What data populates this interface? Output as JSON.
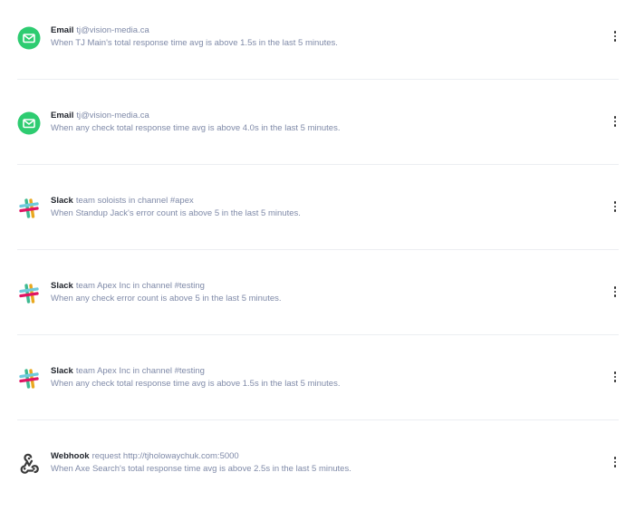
{
  "colors": {
    "email_icon_bg": "#2ecc71",
    "slack_colors": [
      "#3eb991",
      "#e9a820",
      "#e01563",
      "#6ecadc"
    ],
    "text_muted": "#7f8aa8",
    "text_strong": "#1f232b",
    "divider": "#eceef2"
  },
  "alerts": [
    {
      "icon": "email-icon",
      "type": "Email",
      "target": "tj@vision-media.ca",
      "condition": "When TJ Main's total response time avg is above 1.5s in the last 5 minutes."
    },
    {
      "icon": "email-icon",
      "type": "Email",
      "target": "tj@vision-media.ca",
      "condition": "When any check total response time avg is above 4.0s in the last 5 minutes."
    },
    {
      "icon": "slack-icon",
      "type": "Slack",
      "target": "team soloists in channel #apex",
      "condition": "When Standup Jack's error count is above 5 in the last 5 minutes."
    },
    {
      "icon": "slack-icon",
      "type": "Slack",
      "target": "team Apex Inc in channel #testing",
      "condition": "When any check error count is above 5 in the last 5 minutes."
    },
    {
      "icon": "slack-icon",
      "type": "Slack",
      "target": "team Apex Inc in channel #testing",
      "condition": "When any check total response time avg is above 1.5s in the last 5 minutes."
    },
    {
      "icon": "webhook-icon",
      "type": "Webhook",
      "target": "request http://tjholowaychuk.com:5000",
      "condition": "When Axe Search's total response time avg is above 2.5s in the last 5 minutes."
    }
  ]
}
